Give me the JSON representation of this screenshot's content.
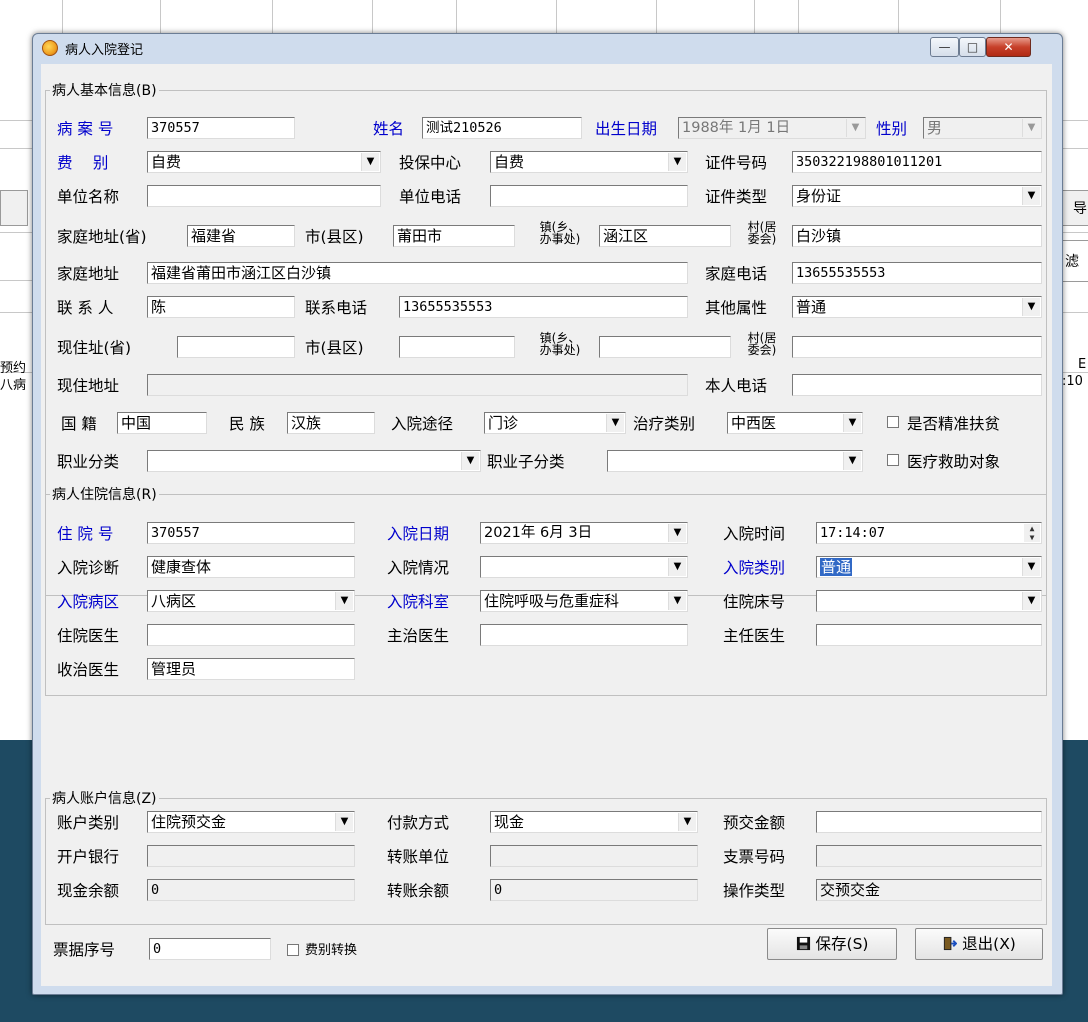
{
  "window": {
    "title": "病人入院登记",
    "controls": {
      "minimize": "—",
      "maximize": "□",
      "close": "✕"
    }
  },
  "background": {
    "side_left": [
      "",
      "",
      "",
      "预约",
      "八病"
    ],
    "side_right": [
      "导",
      "滤",
      "",
      "E",
      ":10"
    ]
  },
  "basic": {
    "legend": "病人基本信息(B)",
    "case_no_label": "病 案 号",
    "case_no": "370557",
    "name_label": "姓名",
    "name": "测试210526",
    "birth_label": "出生日期",
    "birth": "1988年 1月 1日",
    "gender_label": "性别",
    "gender": "男",
    "fee_type_label": "费　 别",
    "fee_type": "自费",
    "insurance_label": "投保中心",
    "insurance": "自费",
    "id_no_label": "证件号码",
    "id_no": "350322198801011201",
    "company_label": "单位名称",
    "company": "",
    "company_phone_label": "单位电话",
    "company_phone": "",
    "id_type_label": "证件类型",
    "id_type": "身份证",
    "home_province_label": "家庭地址(省)",
    "home_province": "福建省",
    "home_city_label": "市(县区)",
    "home_city": "莆田市",
    "town_label_1": "镇(乡、",
    "town_label_2": "办事处)",
    "home_town": "涵江区",
    "village_label_1": "村(居",
    "village_label_2": "委会)",
    "home_village": "白沙镇",
    "home_address_label": "家庭地址",
    "home_address": "福建省莆田市涵江区白沙镇",
    "home_phone_label": "家庭电话",
    "home_phone": "13655535553",
    "contact_label": "联 系 人",
    "contact": "陈",
    "contact_phone_label": "联系电话",
    "contact_phone": "13655535553",
    "other_attr_label": "其他属性",
    "other_attr": "普通",
    "cur_province_label": "现住址(省)",
    "cur_province": "",
    "cur_city_label": "市(县区)",
    "cur_city": "",
    "cur_town": "",
    "cur_village": "",
    "cur_address_label": "现住地址",
    "cur_address": "",
    "self_phone_label": "本人电话",
    "self_phone": "",
    "nationality_label": "国 籍",
    "nationality": "中国",
    "ethnic_label": "民 族",
    "ethnic": "汉族",
    "route_label": "入院途径",
    "route": "门诊",
    "treat_type_label": "治疗类别",
    "treat_type": "中西医",
    "poverty_label": "是否精准扶贫",
    "job_label": "职业分类",
    "job": "",
    "job_sub_label": "职业子分类",
    "job_sub": "",
    "aid_label": "医疗救助对象"
  },
  "stay": {
    "legend": "病人住院信息(R)",
    "hosp_no_label": "住 院 号",
    "hosp_no": "370557",
    "admit_date_label": "入院日期",
    "admit_date": "2021年 6月 3日",
    "admit_time_label": "入院时间",
    "admit_time": "17:14:07",
    "diagnosis_label": "入院诊断",
    "diagnosis": "健康查体",
    "condition_label": "入院情况",
    "condition": "",
    "admit_type_label": "入院类别",
    "admit_type": "普通",
    "ward_label": "入院病区",
    "ward": "八病区",
    "dept_label": "入院科室",
    "dept": "住院呼吸与危重症科",
    "bed_label": "住院床号",
    "bed": "",
    "resident_label": "住院医生",
    "resident": "",
    "attending_label": "主治医生",
    "attending": "",
    "chief_label": "主任医生",
    "chief": "",
    "admitting_label": "收治医生",
    "admitting": "管理员"
  },
  "account": {
    "legend": "病人账户信息(Z)",
    "acct_type_label": "账户类别",
    "acct_type": "住院预交金",
    "pay_method_label": "付款方式",
    "pay_method": "现金",
    "prepay_label": "预交金额",
    "prepay": "",
    "bank_label": "开户银行",
    "bank": "",
    "transfer_unit_label": "转账单位",
    "transfer_unit": "",
    "check_no_label": "支票号码",
    "check_no": "",
    "cash_balance_label": "现金余额",
    "cash_balance": "0",
    "transfer_balance_label": "转账余额",
    "transfer_balance": "0",
    "op_type_label": "操作类型",
    "op_type": "交预交金"
  },
  "footer": {
    "receipt_label": "票据序号",
    "receipt": "0",
    "fee_switch_label": "费别转换",
    "save_label": "保存(S)",
    "exit_label": "退出(X)"
  }
}
